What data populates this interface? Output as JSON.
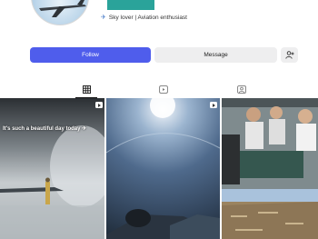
{
  "profile": {
    "bio": "Sky lover | Aviation enthusiast",
    "bio_icon": "airplane-icon"
  },
  "actions": {
    "follow_label": "Follow",
    "message_label": "Message",
    "add_person_icon": "add-person-icon"
  },
  "tabs": [
    {
      "icon": "grid-icon",
      "active": true
    },
    {
      "icon": "reels-icon",
      "active": false
    },
    {
      "icon": "tagged-icon",
      "active": false
    }
  ],
  "posts": [
    {
      "caption": "It's such a beautiful day today ✈",
      "is_reel": true
    },
    {
      "caption": "",
      "is_reel": true
    },
    {
      "caption": "",
      "is_reel": false
    }
  ],
  "colors": {
    "follow_button": "#4f5dec",
    "secondary_button": "#eeeeef",
    "accent_block": "#2aa39a"
  }
}
